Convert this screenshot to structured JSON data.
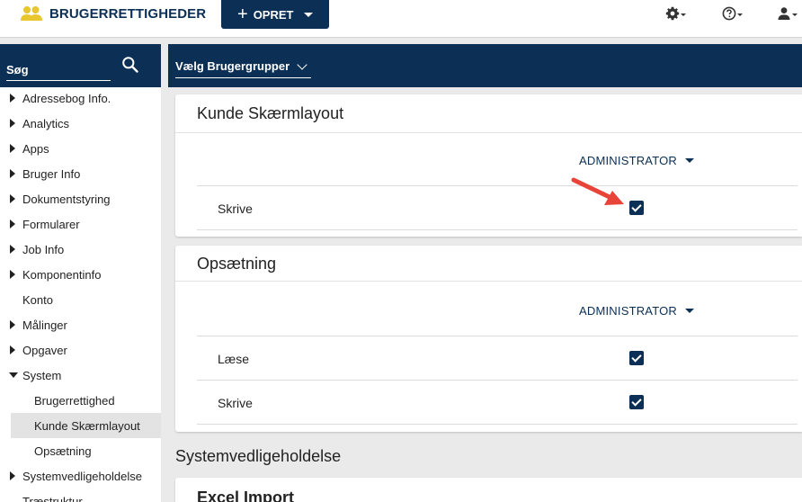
{
  "header": {
    "app_title": "BRUGERRETTIGHEDER",
    "create_button_label": "OPRET",
    "icons": [
      "people-icon",
      "gear-icon",
      "help-icon",
      "user-icon"
    ]
  },
  "sidebar": {
    "search_placeholder": "Søg",
    "items": [
      {
        "label": "Adressebog Info.",
        "expandable": true,
        "expanded": false
      },
      {
        "label": "Analytics",
        "expandable": true,
        "expanded": false
      },
      {
        "label": "Apps",
        "expandable": true,
        "expanded": false
      },
      {
        "label": "Bruger Info",
        "expandable": true,
        "expanded": false
      },
      {
        "label": "Dokumentstyring",
        "expandable": true,
        "expanded": false
      },
      {
        "label": "Formularer",
        "expandable": true,
        "expanded": false
      },
      {
        "label": "Job Info",
        "expandable": true,
        "expanded": false
      },
      {
        "label": "Komponentinfo",
        "expandable": true,
        "expanded": false
      },
      {
        "label": "Konto",
        "expandable": false,
        "expanded": false
      },
      {
        "label": "Målinger",
        "expandable": true,
        "expanded": false
      },
      {
        "label": "Opgaver",
        "expandable": true,
        "expanded": false
      },
      {
        "label": "System",
        "expandable": true,
        "expanded": true
      },
      {
        "label": "Brugerrettighed",
        "sub": true
      },
      {
        "label": "Kunde Skærmlayout",
        "sub": true,
        "active": true
      },
      {
        "label": "Opsætning",
        "sub": true
      },
      {
        "label": "Systemvedligeholdelse",
        "expandable": true,
        "expanded": false
      },
      {
        "label": "Træstruktur",
        "expandable": false,
        "expanded": false
      }
    ]
  },
  "main": {
    "group_select_label": "Vælg Brugergrupper",
    "cards": [
      {
        "title": "Kunde Skærmlayout",
        "column": "ADMINISTRATOR",
        "rows": [
          {
            "label": "Skrive",
            "checked": true
          }
        ]
      },
      {
        "title": "Opsætning",
        "column": "ADMINISTRATOR",
        "rows": [
          {
            "label": "Læse",
            "checked": true
          },
          {
            "label": "Skrive",
            "checked": true
          }
        ]
      }
    ],
    "section_title": "Systemvedligeholdelse",
    "next_card_title": "Excel Import"
  },
  "colors": {
    "navy": "#0b2f55",
    "accent_yellow": "#e7c62e",
    "annotation_red": "#e8443a"
  }
}
